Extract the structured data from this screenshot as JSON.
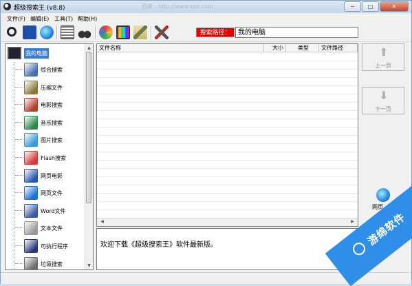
{
  "window": {
    "title": "超级搜索王 (v8.8)",
    "title_ghost": "百度 - http://www.xxx.com",
    "controls": {
      "minimize": "─",
      "maximize": "□",
      "close": "✕"
    }
  },
  "menu": [
    {
      "label": "文件(F)"
    },
    {
      "label": "编辑(E)"
    },
    {
      "label": "工具(T)"
    },
    {
      "label": "帮助(H)"
    }
  ],
  "toolbar": {
    "buttons": [
      {
        "name": "search-toolbar-button",
        "icon": "search-icon",
        "color": "#222222"
      },
      {
        "name": "save-toolbar-button",
        "icon": "save-icon",
        "color": "#1d4fa8"
      },
      {
        "name": "web-toolbar-button",
        "icon": "ie-icon",
        "color": "#1a74d8"
      },
      {
        "name": "list-toolbar-button",
        "icon": "list-icon",
        "color": "#777777"
      },
      {
        "name": "binoculars-toolbar-button",
        "icon": "binoculars-icon",
        "color": "#333333"
      },
      {
        "name": "movie-toolbar-button",
        "icon": "film-icon",
        "color": "#b83a2a"
      },
      {
        "name": "monitor-toolbar-button",
        "icon": "monitor-icon",
        "color": "#444444"
      },
      {
        "name": "clean-toolbar-button",
        "icon": "broom-icon",
        "color": "#6c7a4a"
      },
      {
        "name": "tools-toolbar-button",
        "icon": "tools-icon",
        "color": "#555555"
      }
    ],
    "search_path_label": "搜索路径：",
    "search_path_value": "我的电脑"
  },
  "tree": {
    "root": "我的电脑",
    "items": [
      {
        "label": "综合搜索",
        "icon": "multi-search-icon",
        "color": "#4a6fb0"
      },
      {
        "label": "压缩文件",
        "icon": "archive-icon",
        "color": "#8a7a3a"
      },
      {
        "label": "电影搜索",
        "icon": "film-icon",
        "color": "#b83a2a"
      },
      {
        "label": "音乐搜索",
        "icon": "music-icon",
        "color": "#2a8a4a"
      },
      {
        "label": "图片搜索",
        "icon": "picture-icon",
        "color": "#3a9ad8"
      },
      {
        "label": "Flash搜索",
        "icon": "flash-icon",
        "color": "#d83a3a"
      },
      {
        "label": "网页电影",
        "icon": "web-movie-icon",
        "color": "#2a5ab0"
      },
      {
        "label": "网页文件",
        "icon": "ie-icon",
        "color": "#1a74d8"
      },
      {
        "label": "Word文件",
        "icon": "word-icon",
        "color": "#3a5aa8"
      },
      {
        "label": "文本文件",
        "icon": "text-file-icon",
        "color": "#9a9a9a"
      },
      {
        "label": "可执行程序",
        "icon": "exe-icon",
        "color": "#2a3a7a"
      },
      {
        "label": "垃圾搜索",
        "icon": "trash-icon",
        "color": "#6a6a6a"
      }
    ]
  },
  "list": {
    "columns": [
      {
        "label": "文件名称"
      },
      {
        "label": "大小"
      },
      {
        "label": "类型"
      },
      {
        "label": "文件路径"
      }
    ]
  },
  "message": "欢迎下载《超级搜索王》软件最新版。",
  "nav": {
    "prev_label": "上一页",
    "next_label": "下一页",
    "web_label": "网页"
  },
  "watermark": {
    "text": "游绵软件"
  }
}
